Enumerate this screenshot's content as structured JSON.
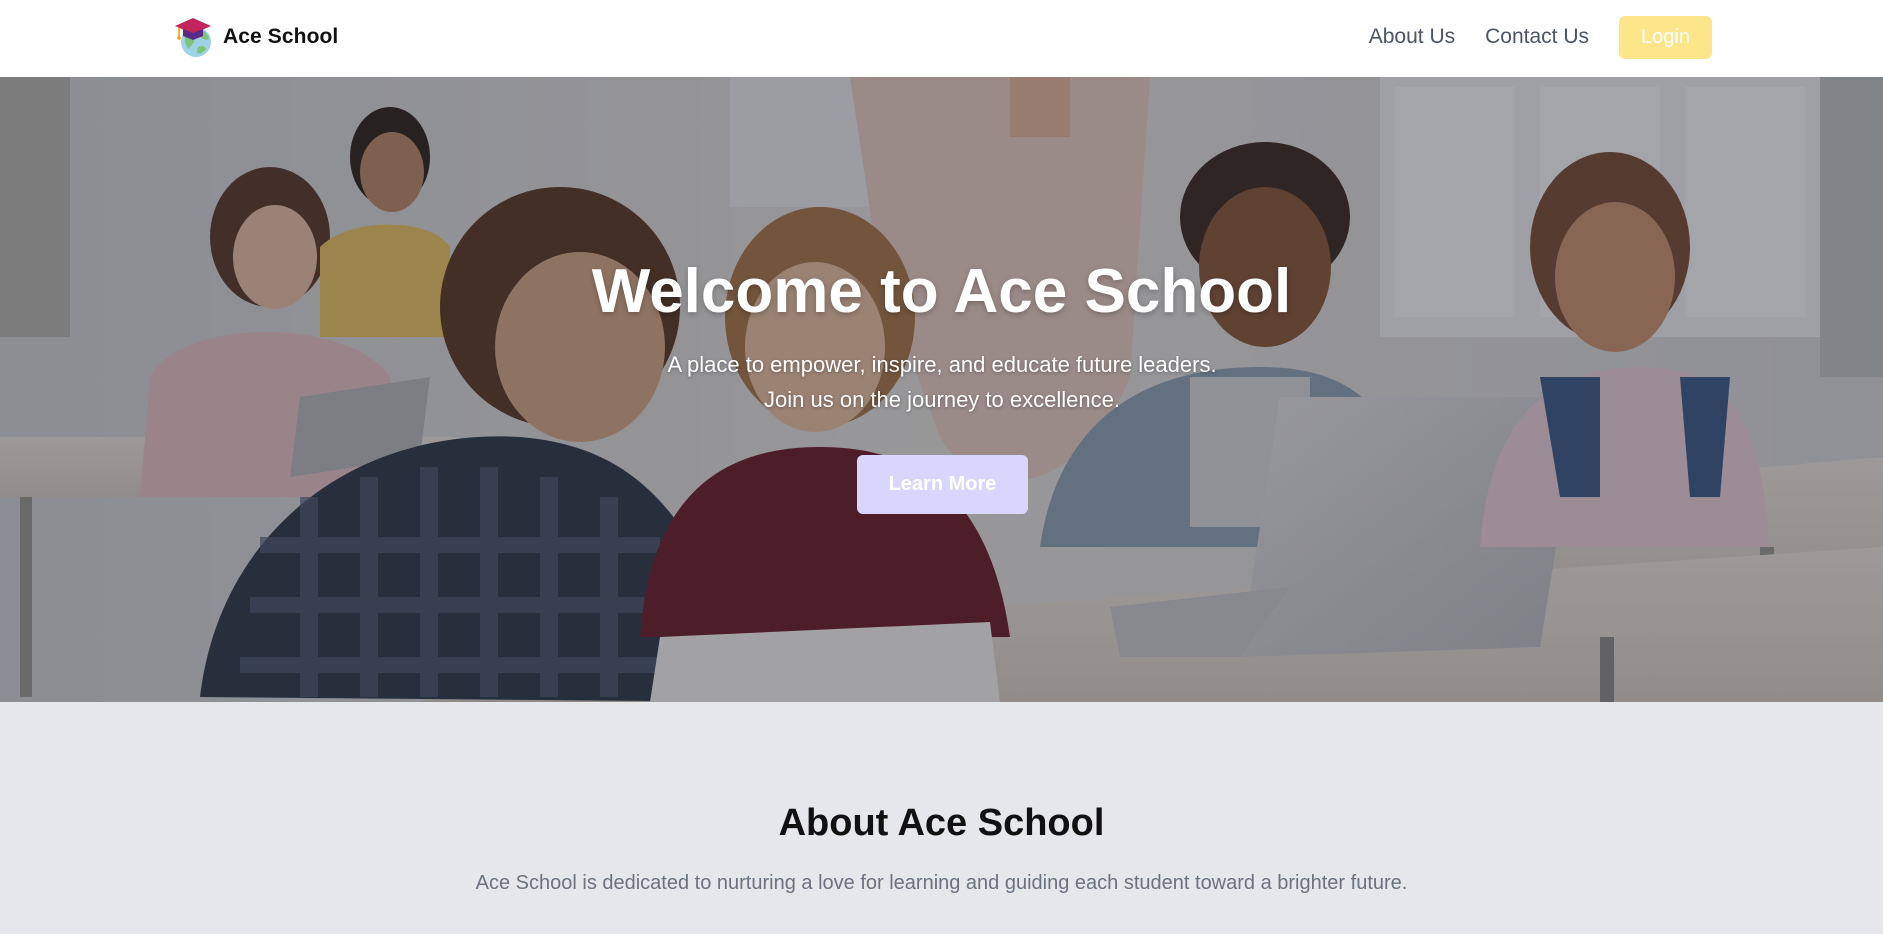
{
  "header": {
    "brand_name": "Ace School",
    "brand_logo_icon": "graduation-cap-globe-icon",
    "nav": {
      "about_label": "About Us",
      "contact_label": "Contact Us",
      "login_label": "Login"
    }
  },
  "hero": {
    "title": "Welcome to Ace School",
    "subtitle": "A place to empower, inspire, and educate future leaders. Join us on the journey to excellence.",
    "cta_label": "Learn More"
  },
  "about": {
    "title": "About Ace School",
    "text": "Ace School is dedicated to nurturing a love for learning and guiding each student toward a brighter future."
  },
  "colors": {
    "header_bg": "#ffffff",
    "login_button_bg": "#fde68a",
    "learn_more_bg": "#d9d6fe",
    "about_bg": "#e5e7eb",
    "nav_text": "#4b5563",
    "about_text": "#6b7280"
  }
}
